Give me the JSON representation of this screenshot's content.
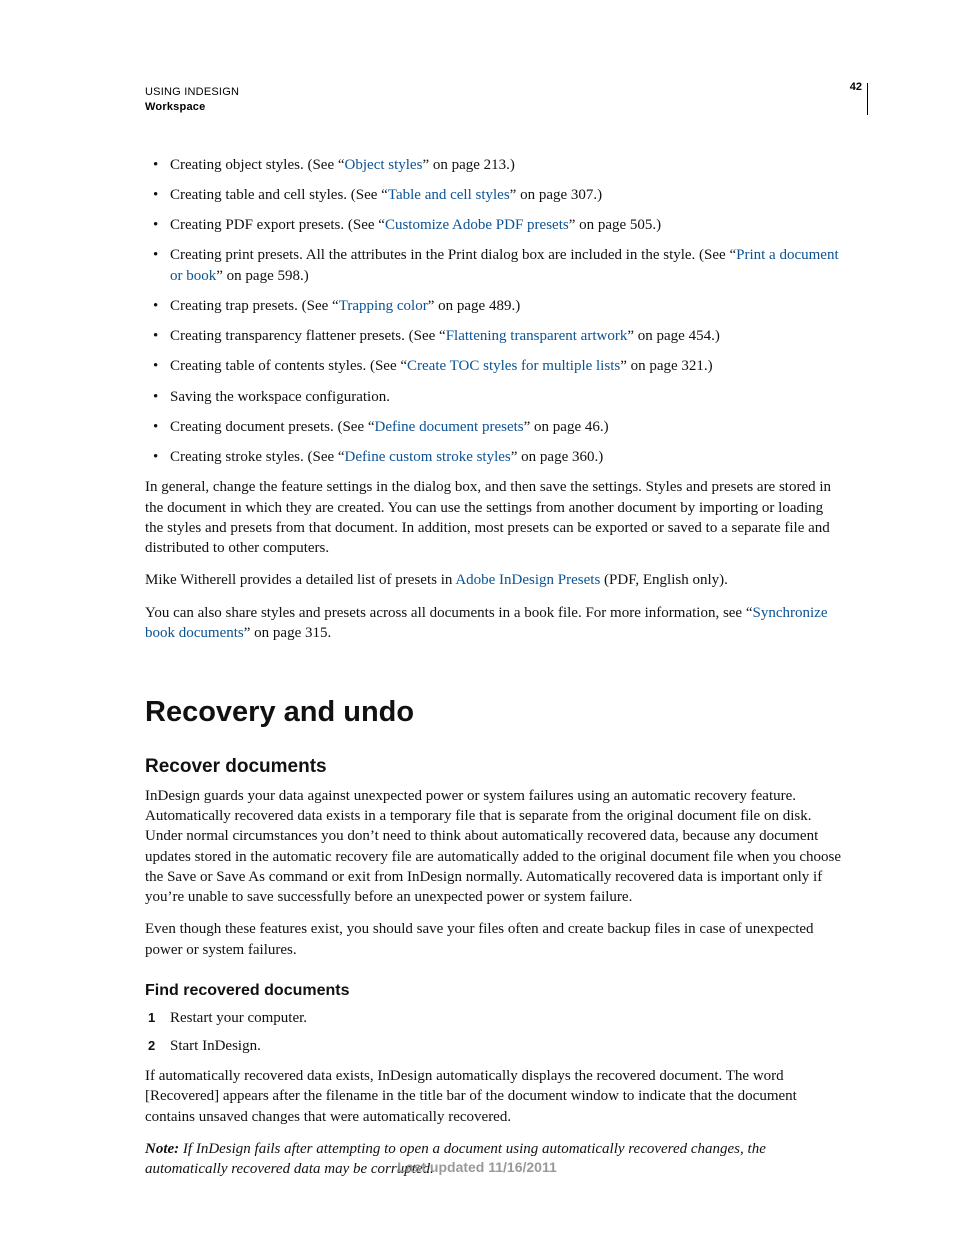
{
  "header": {
    "line1": "USING INDESIGN",
    "line2": "Workspace",
    "page_number": "42"
  },
  "bullets": [
    {
      "pre": "Creating object styles. (See “",
      "link": "Object styles",
      "post": "” on page 213.)"
    },
    {
      "pre": "Creating table and cell styles. (See “",
      "link": "Table and cell styles",
      "post": "” on page 307.)"
    },
    {
      "pre": "Creating PDF export presets. (See “",
      "link": "Customize Adobe PDF presets",
      "post": "” on page 505.)"
    },
    {
      "pre": "Creating print presets. All the attributes in the Print dialog box are included in the style. (See “",
      "link": "Print a document or book",
      "post": "” on page 598.)"
    },
    {
      "pre": "Creating trap presets. (See “",
      "link": "Trapping color",
      "post": "” on page 489.)"
    },
    {
      "pre": "Creating transparency flattener presets. (See “",
      "link": "Flattening transparent artwork",
      "post": "” on page 454.)"
    },
    {
      "pre": "Creating table of contents styles. (See “",
      "link": "Create TOC styles for multiple lists",
      "post": "” on page 321.)"
    },
    {
      "pre": "Saving the workspace configuration.",
      "link": "",
      "post": ""
    },
    {
      "pre": "Creating document presets. (See “",
      "link": "Define document presets",
      "post": "” on page 46.)"
    },
    {
      "pre": "Creating stroke styles. (See “",
      "link": "Define custom stroke styles",
      "post": "” on page 360.)"
    }
  ],
  "para1": "In general, change the feature settings in the dialog box, and then save the settings. Styles and presets are stored in the document in which they are created. You can use the settings from another document by importing or loading the styles and presets from that document. In addition, most presets can be exported or saved to a separate file and distributed to other computers.",
  "para2_pre": "Mike Witherell provides a detailed list of presets in ",
  "para2_link": "Adobe InDesign Presets",
  "para2_post": " (PDF, English only).",
  "para3_pre": "You can also share styles and presets across all documents in a book file. For more information, see “",
  "para3_link": "Synchronize book documents",
  "para3_post": "” on page 315.",
  "section_title": "Recovery and undo",
  "subhead1": "Recover documents",
  "recover_para1": "InDesign guards your data against unexpected power or system failures using an automatic recovery feature. Automatically recovered data exists in a temporary file that is separate from the original document file on disk. Under normal circumstances you don’t need to think about automatically recovered data, because any document updates stored in the automatic recovery file are automatically added to the original document file when you choose the Save or Save As command or exit from InDesign normally. Automatically recovered data is important only if you’re unable to save successfully before an unexpected power or system failure.",
  "recover_para2": "Even though these features exist, you should save your files often and create backup files in case of unexpected power or system failures.",
  "subsubhead1": "Find recovered documents",
  "steps": [
    "Restart your computer.",
    "Start InDesign."
  ],
  "after_steps_para": "If automatically recovered data exists, InDesign automatically displays the recovered document. The word [Recovered] appears after the filename in the title bar of the document window to indicate that the document contains unsaved changes that were automatically recovered.",
  "note_label": "Note:",
  "note_text": " If InDesign fails after attempting to open a document using automatically recovered changes, the automatically recovered data may be corrupted.",
  "footer": "Last updated 11/16/2011"
}
